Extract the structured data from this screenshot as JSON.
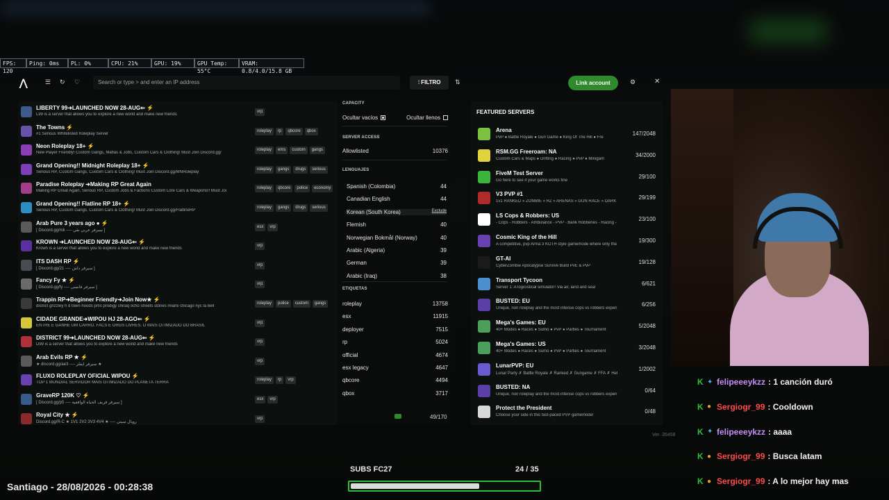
{
  "stats": [
    "FPS: 120",
    "Ping: 0ms",
    "PL: 0%",
    "CPU: 21%",
    "GPU: 19%",
    "GPU Temp: 55°C",
    "VRAM: 0.8/4.0/15.8 GB"
  ],
  "toolbar": {
    "logo": "⋀",
    "search_placeholder": "Search or type > and enter an IP address",
    "filter_label": "FILTRO",
    "link_account": "Link account"
  },
  "servers": [
    {
      "name": "LIBERTY 99➜LAUNCHED NOW 28-AUG⇐ ⚡",
      "desc": "L99 is a server that allows you to explore a new world and make new friends",
      "tags": [
        "vrp"
      ],
      "color": "#3d5b8a"
    },
    {
      "name": "The Towns ⚡",
      "desc": "#1 Serious Whitelisted Roleplay Server",
      "tags": [
        "roleplay",
        "rp",
        "qbcore",
        "qbox"
      ],
      "color": "#6a52a8"
    },
    {
      "name": "Neon Roleplay 18+ ⚡",
      "desc": "New Player Friendly! Custom Gangs, Mafias & Jobs, Custom Cars & Clothing! Must Join Discord.gg/",
      "tags": [
        "roleplay",
        "ems",
        "custom",
        "gangs"
      ],
      "color": "#8b3fb5"
    },
    {
      "name": "Grand Opening!! Midnight Roleplay 18+ ⚡",
      "desc": "Serious RP, Custom Gangs, Custom Cars & Clothing! Must Join Discord.gg/MNRoleplay",
      "tags": [
        "roleplay",
        "gangs",
        "drugs",
        "serious"
      ],
      "color": "#7d3fb8"
    },
    {
      "name": "Paradise Roleplay ➜Making RP Great Again",
      "desc": "Making RP Great Again, Serious RP, Custom Jobs & Factions Custom Lore Cars & Weapons!! Must Joi",
      "tags": [
        "roleplay",
        "qbcore",
        "police",
        "economy"
      ],
      "color": "#a33d8a"
    },
    {
      "name": "Grand Opening!! Flatline RP 18+ ⚡",
      "desc": "Serious RP, Custom Gangs, Custom Cars & Clothing! Must Join Discord.gg/FlatlineRP",
      "tags": [
        "roleplay",
        "gangs",
        "drugs",
        "serious"
      ],
      "color": "#2b8fc4"
    },
    {
      "name": "Arab Pure 3 years ago ● ⚡",
      "desc": "[ Discord.gg/mk ---- سيرفر عربي نقي ]",
      "tags": [
        "esx",
        "vrp"
      ],
      "color": "#5a5a5a"
    },
    {
      "name": "KROWN ➜LAUNCHED NOW 28-AUG⇐ ⚡",
      "desc": "Krown is a server that allows you to explore a new world and make new friends",
      "tags": [
        "vrp"
      ],
      "color": "#5a2fa0"
    },
    {
      "name": "ITS DASH RP ⚡",
      "desc": "[ Discord.gg/21 ---- سيرفر داش ]",
      "tags": [
        "vrp"
      ],
      "color": "#4a4a55"
    },
    {
      "name": "Fancy Fy ★ ⚡",
      "desc": "[ Discord.gg/fy ---- سيرفر فانسي ]",
      "tags": [
        "vrp"
      ],
      "color": "#6a6a6a"
    },
    {
      "name": "Trappin RP➜Beginner Friendly➜Join Now★ ⚡",
      "desc": "district grizzley h d town hoods pms prodigy chiraq ocho streets stories miami chicago nyc la bell",
      "tags": [
        "roleplay",
        "police",
        "custom",
        "gangs"
      ],
      "color": "#3a3a3a"
    },
    {
      "name": "CIDADE GRANDE➜WIPOU HJ 28-AGO⇐ ⚡",
      "desc": "ENTRE E GANHE UM CARRO. FACS E ORGS LIVRES. O MAIS OTIMIZADO DO BRASIL",
      "tags": [
        "vrp"
      ],
      "color": "#d6c73a"
    },
    {
      "name": "DISTRICT 99➜LAUNCHED NOW 28-AUG⇐ ⚡",
      "desc": "D99 is a server that allows you to explore a new world and make new friends",
      "tags": [
        "vrp"
      ],
      "color": "#b0303a"
    },
    {
      "name": "Arab Evils RP ★ ⚡",
      "desc": "★ discord.gg/ae3 ---- سيرفر ايفلز ★",
      "tags": [
        "vrp"
      ],
      "color": "#5a5a5a"
    },
    {
      "name": "FLUXO ROLEPLAY OFICIAL WIPOU ⚡",
      "desc": "TOP 1 MUNDIAL SERVIDOR MAIS OTIMIZADO DO PLANETA TERRA",
      "tags": [
        "roleplay",
        "rp",
        "vrp"
      ],
      "color": "#6a3fb0"
    },
    {
      "name": "GraveRP 120K ♡ ⚡",
      "desc": "[ Discord.gg/p5 ---- سيرفر قريف الحياة الواقعية ]",
      "tags": [
        "esx",
        "vrp"
      ],
      "color": "#3a5a8a"
    },
    {
      "name": "Royal City ★ ⚡",
      "desc": "Discord.gg/R-C ★ 1V1 2V2 3V3 4V4 ★ ---- رويال سيتي",
      "tags": [
        "vrp"
      ],
      "color": "#8a2a2a"
    }
  ],
  "filter": {
    "capacity_heading": "CAPACITY",
    "hide_empty": "Ocultar vacíos",
    "hide_full": "Ocultar llenos",
    "server_access_heading": "SERVER ACCESS",
    "allowlisted": "Allowlisted",
    "allowlisted_count": "10376",
    "languages_heading": "LENGUAJES",
    "exclude_label": "Exclude",
    "languages": [
      {
        "name": "Spanish (Colombia)",
        "count": "44"
      },
      {
        "name": "Canadian English",
        "count": "44"
      },
      {
        "name": "Korean (South Korea)",
        "count": ""
      },
      {
        "name": "Flemish",
        "count": "40"
      },
      {
        "name": "Norwegian Bokmål (Norway)",
        "count": "40"
      },
      {
        "name": "Arabic (Algeria)",
        "count": "39"
      },
      {
        "name": "German",
        "count": "39"
      },
      {
        "name": "Arabic (Iraq)",
        "count": "38"
      }
    ],
    "tags_heading": "ETIQUETAS",
    "tags": [
      {
        "name": "roleplay",
        "count": "13758"
      },
      {
        "name": "esx",
        "count": "11915"
      },
      {
        "name": "deployer",
        "count": "7515"
      },
      {
        "name": "rp",
        "count": "5024"
      },
      {
        "name": "official",
        "count": "4674"
      },
      {
        "name": "esx legacy",
        "count": "4647"
      },
      {
        "name": "qbcore",
        "count": "4494"
      },
      {
        "name": "qbox",
        "count": "3717"
      }
    ],
    "page_count": "49/170"
  },
  "featured": {
    "title": "FEATURED SERVERS",
    "items": [
      {
        "name": "Arena",
        "desc": "PvP ● Battle Royale ● Gun Game ● King Of The Hill ● Fre",
        "players": "147/2048",
        "color": "#7cc142"
      },
      {
        "name": "RSM.GG Freeroam: NA",
        "desc": "Custom Cars & Maps ● Drifting ● Racing ● PvP ● Minigam",
        "players": "34/2000",
        "color": "#e0d43a"
      },
      {
        "name": "FiveM Test Server",
        "desc": "Go here to see if your game works fine",
        "players": "29/100",
        "color": "#3cb43c"
      },
      {
        "name": "V3 PVP #1",
        "desc": "1v1 RANKED » ZOMBIE » RZ » ARENAS » GUN RACE » DARK",
        "players": "29/199",
        "color": "#b02a2a"
      },
      {
        "name": "LS Cops & Robbers: US",
        "desc": "- Cops - Robbers - Ambulance - PVP - Bank Robberies - Racing -",
        "players": "23/100",
        "color": "#ffffff"
      },
      {
        "name": "Cosmic King of the Hill",
        "desc": "A competitive, pvp Arma 3 KOTH style gamemode where only the",
        "players": "19/300",
        "color": "#6a3fb0"
      },
      {
        "name": "GT-AI",
        "desc": "CyberZombie Apocalypse Survive Build PvE & PvP",
        "players": "19/128",
        "color": "#1a1a1a"
      },
      {
        "name": "Transport Tycoon",
        "desc": "Server 1: A logicistical simulator! Via air, land and sea!",
        "players": "6/621",
        "color": "#4a8fd0"
      },
      {
        "name": "BUSTED: EU",
        "desc": "Unique, non roleplay and the most intense cops vs robbers experi",
        "players": "6/256",
        "color": "#5a3fa8"
      },
      {
        "name": "Mega's Games: EU",
        "desc": "40+ Modes ● Races ● Sumo ● PvP ● Parties ● Tournament",
        "players": "5/2048",
        "color": "#4aa05a"
      },
      {
        "name": "Mega's Games: US",
        "desc": "40+ Modes ● Races ● Sumo ● PvP ● Parties ● Tournament",
        "players": "3/2048",
        "color": "#4aa05a"
      },
      {
        "name": "LunarPVP: EU",
        "desc": "Lunar Party ✗ Battle Royale ✗ Ranked ✗ Gungame ✗ FFA ✗ Hel",
        "players": "1/2002",
        "color": "#6a5ad0"
      },
      {
        "name": "BUSTED: NA",
        "desc": "Unique, non roleplay and the most intense cops vs robbers experi",
        "players": "0/64",
        "color": "#5a3fa8"
      },
      {
        "name": "Protect the President",
        "desc": "Choose your side in this fast-paced PVP gamemode!",
        "players": "0/48",
        "color": "#d8d8d8"
      }
    ]
  },
  "version": "Ver. 35458",
  "chat": [
    {
      "user": "felipeeeykzz",
      "text": ": 1 canción duró",
      "color": "#c58ef2",
      "badge2": "✦"
    },
    {
      "user": "Sergiogr_99",
      "text": ": Cooldown",
      "color": "#ff4a4a",
      "badge2": "●"
    },
    {
      "user": "felipeeeykzz",
      "text": ": aaaa",
      "color": "#c58ef2",
      "badge2": "✦"
    },
    {
      "user": "Sergiogr_99",
      "text": ": Busca latam",
      "color": "#ff4a4a",
      "badge2": "●"
    },
    {
      "user": "Sergiogr_99",
      "text": ": A lo mejor hay mas",
      "color": "#ff4a4a",
      "badge2": "●"
    }
  ],
  "clock": "Santiago - 28/08/2026 - 00:28:38",
  "subs": {
    "label": "SUBS FC27",
    "count": "24 / 35",
    "progress": 0.6857
  }
}
